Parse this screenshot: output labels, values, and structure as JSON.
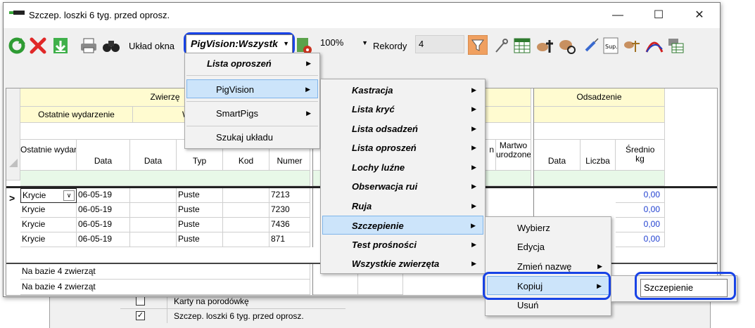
{
  "window": {
    "title": "Szczep. loszki 6 tyg. przed oprosz.",
    "minimize": "—",
    "maximize": "☐",
    "close": "✕"
  },
  "toolbar": {
    "layout_label": "Układ okna",
    "layout_value": "PigVision:Wszystk",
    "zoom_value": "100%",
    "records_label": "Rekordy",
    "records_value": "4"
  },
  "colors": {
    "highlight": "#1843e6",
    "header_bg": "#fffbd0",
    "link_blue": "#1f3fd0"
  },
  "grid": {
    "groups": {
      "zwierze": "Zwierzę",
      "odsadzenie": "Odsadzenie"
    },
    "subgroups": {
      "ostatnie_wydarzenie": "Ostatnie wydarzenie",
      "w": "W"
    },
    "columns": {
      "ostatnie": "Ostatnie wydarzenie",
      "data1": "Data",
      "data2": "Data",
      "typ": "Typ",
      "kod": "Kod",
      "numer": "Numer",
      "n": "n",
      "martwo": "Martwo urodzone",
      "data3": "Data",
      "liczba": "Liczba",
      "srednio": "Średnio kg"
    },
    "rows": [
      {
        "event": "Krycie",
        "date": "06-05-19",
        "typ": "Puste",
        "numer": "7213",
        "srednio": "0,00"
      },
      {
        "event": "Krycie",
        "date": "06-05-19",
        "typ": "Puste",
        "numer": "7230",
        "srednio": "0,00"
      },
      {
        "event": "Krycie",
        "date": "06-05-19",
        "typ": "Puste",
        "numer": "7436",
        "srednio": "0,00"
      },
      {
        "event": "Krycie",
        "date": "06-05-19",
        "typ": "Puste",
        "numer": "871",
        "srednio": "0,00"
      }
    ],
    "footer": [
      "Na bazie 4 zwierząt",
      "Na bazie 4 zwierząt"
    ]
  },
  "menu1": {
    "items": [
      "Lista oproszeń",
      "PigVision",
      "SmartPigs",
      "Szukaj układu"
    ]
  },
  "menu2": {
    "items": [
      "Kastracja",
      "Lista kryć",
      "Lista odsadzeń",
      "Lista oproszeń",
      "Lochy luźne",
      "Obserwacja rui",
      "Ruja",
      "Szczepienie",
      "Test prośności",
      "Wszystkie zwierzęta"
    ]
  },
  "menu3": {
    "items": [
      "Wybierz",
      "Edycja",
      "Zmień nazwę",
      "Kopiuj",
      "Usuń"
    ]
  },
  "copy_name_value": "Szczepienie",
  "background_list": {
    "items": [
      {
        "label": "Karty na porodówkę",
        "checked": ""
      },
      {
        "label": "Szczep. loszki 6 tyg. przed oprosz.",
        "checked": "✓"
      }
    ]
  }
}
